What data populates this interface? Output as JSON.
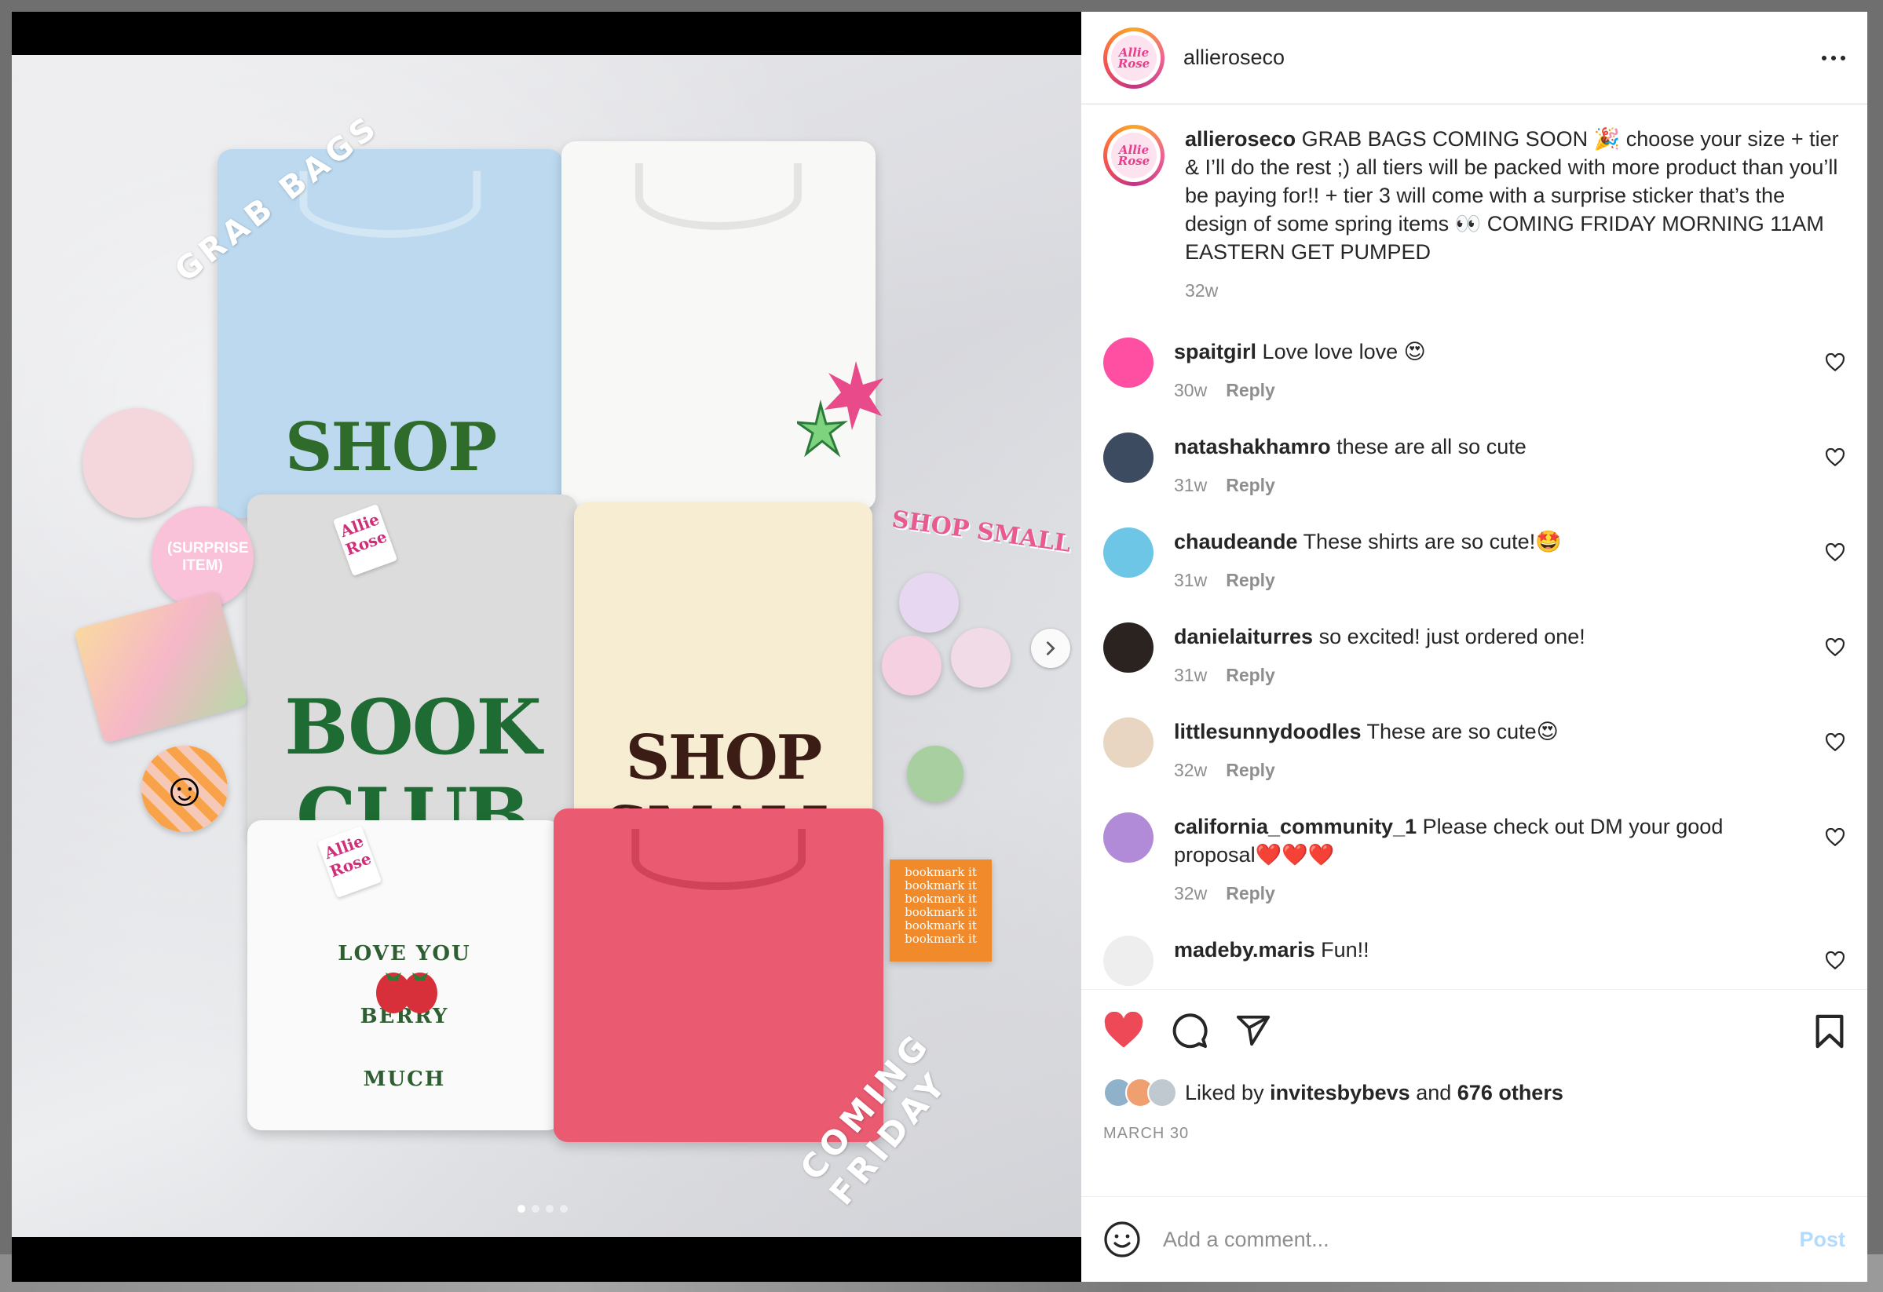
{
  "post": {
    "username": "allieroseco",
    "caption": "GRAB BAGS COMING SOON 🎉 choose your size + tier & I’ll do the rest ;) all tiers will be packed with more product than you’ll be paying for!! + tier 3 will come with a surprise sticker that’s the design of some spring items 👀 COMING FRIDAY MORNING 11AM EASTERN GET PUMPED",
    "caption_time": "32w",
    "logo_text": "Allie Rose"
  },
  "photo": {
    "overlay_top": "GRAB BAGS",
    "overlay_bottom": "COMING FRIDAY",
    "surprise_label": "(SURPRISE ITEM)",
    "shirts": [
      {
        "print": "SHOP SMALL",
        "color": "#bcd9ef",
        "ink": "#2f6b2a"
      },
      {
        "print": "",
        "color": "#f8f8f6",
        "ink": "#e84a8a"
      },
      {
        "print": "BOOK CLUB",
        "color": "#dcdcdc",
        "ink": "#1f6b34"
      },
      {
        "print": "SHOP SMALL",
        "color": "#f6edd2",
        "ink": "#3b1d16"
      },
      {
        "print": "LOVE YOU BERRY MUCH",
        "color": "#fafafa",
        "ink": "#2e5e31"
      },
      {
        "print": "",
        "color": "#ea5a70",
        "ink": "#1f5a2d"
      }
    ],
    "tag_text": "Allie Rose",
    "sticker_text": "SHOP SMALL",
    "bookmark_text": "bookmark it",
    "total_slides": 4,
    "active_slide": 1
  },
  "comments": [
    {
      "user": "spaitgirl",
      "text": "Love love love 😍",
      "time": "30w",
      "reply": "Reply",
      "avatar_color": "#ff4fa3"
    },
    {
      "user": "natashakhamro",
      "text": "these are all so cute",
      "time": "31w",
      "reply": "Reply",
      "avatar_color": "#3c4b60"
    },
    {
      "user": "chaudeande",
      "text": "These shirts are so cute!🤩",
      "time": "31w",
      "reply": "Reply",
      "avatar_color": "#6ec6e6"
    },
    {
      "user": "danielaiturres",
      "text": "so excited! just ordered one!",
      "time": "31w",
      "reply": "Reply",
      "avatar_color": "#2b2320"
    },
    {
      "user": "littlesunnydoodles",
      "text": "These are so cute😍",
      "time": "32w",
      "reply": "Reply",
      "avatar_color": "#e9d6c2"
    },
    {
      "user": "california_community_1",
      "text": "Please check out DM your good proposal❤️❤️❤️",
      "time": "32w",
      "reply": "Reply",
      "avatar_color": "#b28bd8"
    },
    {
      "user": "madeby.maris",
      "text": "Fun!!",
      "time": "",
      "reply": "",
      "avatar_color": "#eeeeee"
    }
  ],
  "likes": {
    "prefix": "Liked by",
    "first_liker": "invitesbybevs",
    "connector": "and",
    "others": "676 others",
    "avatar_colors": [
      "#8fb1c9",
      "#f0a070",
      "#c0c8d0"
    ]
  },
  "date": "MARCH 30",
  "composer": {
    "placeholder": "Add a comment...",
    "post_label": "Post"
  },
  "colors": {
    "heart": "#ed4956",
    "post_disabled": "#b3dbff",
    "text": "#262626",
    "muted": "#8e8e8e"
  }
}
